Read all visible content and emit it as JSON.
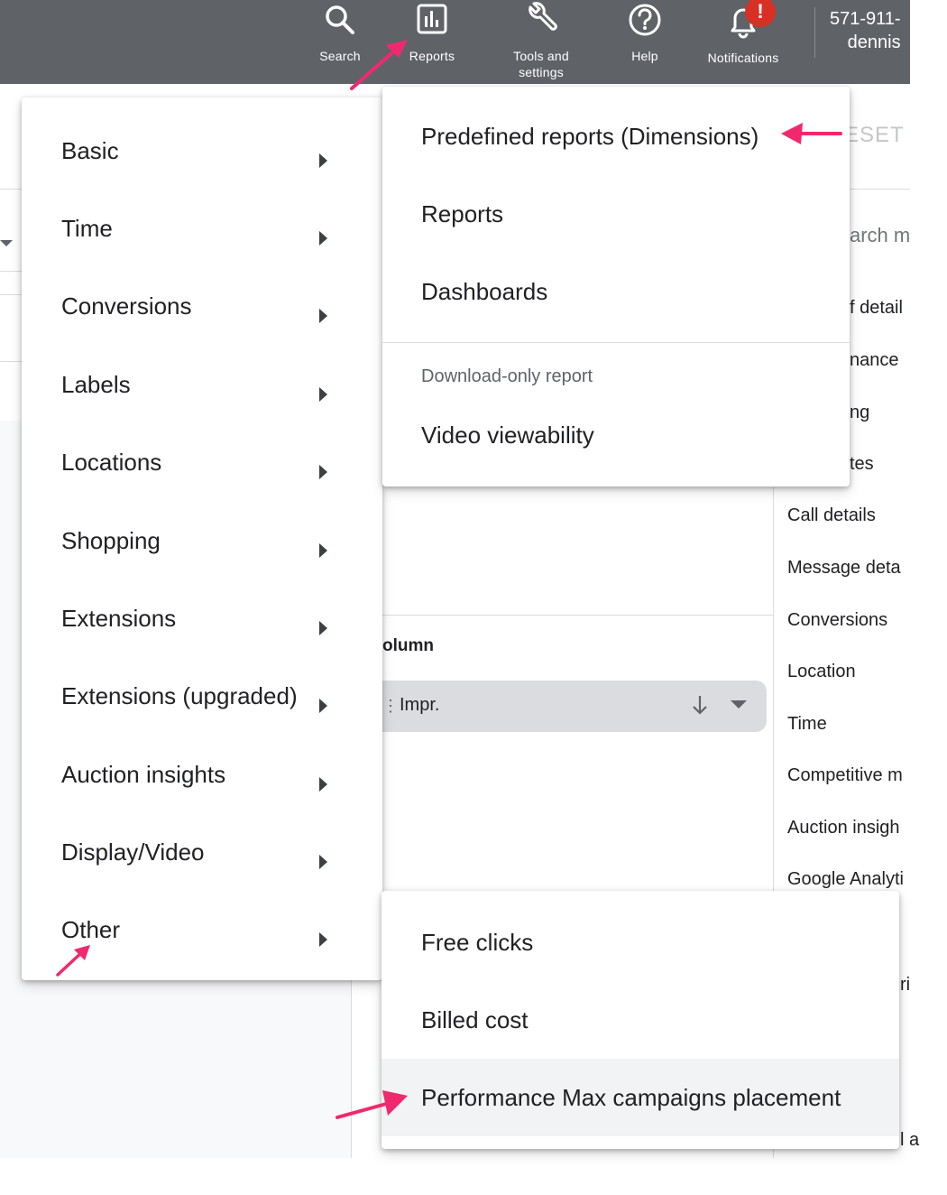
{
  "topbar": {
    "search_label": "Search",
    "reports_label": "Reports",
    "tools_label_line1": "Tools and",
    "tools_label_line2": "settings",
    "help_label": "Help",
    "notifications_label": "Notifications",
    "notification_badge": "!",
    "account_phone": "571-911-",
    "account_name": "dennis"
  },
  "background": {
    "reset_label": "ESET",
    "search_fragment": "arch m",
    "right_fragments": [
      "f detail",
      "nance",
      "ng",
      "tes"
    ],
    "right_items": [
      "Call details",
      "Message deta",
      "Conversions",
      "Location",
      "Time",
      "Competitive m",
      "Auction insigh",
      "Google Analyti"
    ],
    "edge_fragments": [
      "ri",
      "l a"
    ],
    "column_label": "olumn",
    "column_value": "Impr."
  },
  "left_menu": {
    "items": [
      "Basic",
      "Time",
      "Conversions",
      "Labels",
      "Locations",
      "Shopping",
      "Extensions",
      "Extensions (upgraded)",
      "Auction insights",
      "Display/Video",
      "Other"
    ]
  },
  "reports_menu": {
    "items": [
      "Predefined reports (Dimensions)",
      "Reports",
      "Dashboards"
    ],
    "section_header": "Download-only report",
    "section_item": "Video viewability"
  },
  "other_submenu": {
    "items": [
      "Free clicks",
      "Billed cost",
      "Performance Max campaigns placement"
    ]
  },
  "colors": {
    "topbar": "#5f6368",
    "annotation_arrow": "#f0296e",
    "alert_badge": "#d93025"
  }
}
